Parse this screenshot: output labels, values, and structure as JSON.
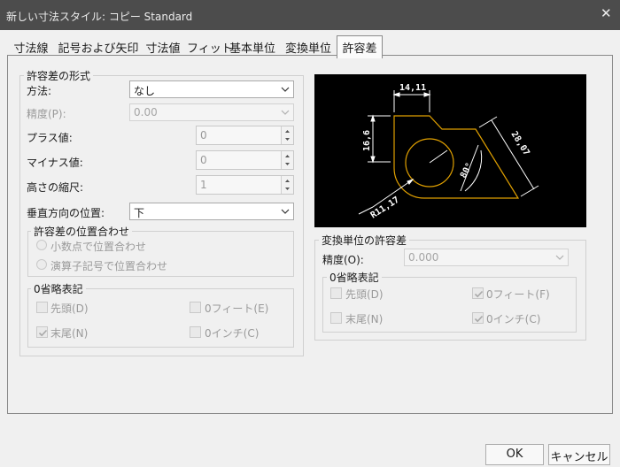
{
  "window": {
    "title": "新しい寸法スタイル: コピー Standard",
    "close_glyph": "✕"
  },
  "tabs": [
    {
      "label": "寸法線",
      "active": false
    },
    {
      "label": "記号および矢印",
      "active": false
    },
    {
      "label": "寸法値",
      "active": false
    },
    {
      "label": "フィット",
      "active": false
    },
    {
      "label": "基本単位",
      "active": false
    },
    {
      "label": "変換単位",
      "active": false
    },
    {
      "label": "許容差",
      "active": true
    }
  ],
  "tolerance_format": {
    "group_title": "許容差の形式",
    "method_label": "方法:",
    "method_value": "なし",
    "precision_label": "精度(P):",
    "precision_value": "0.00",
    "plus_label": "プラス値:",
    "plus_value": "0",
    "minus_label": "マイナス値:",
    "minus_value": "0",
    "height_scale_label": "高さの縮尺:",
    "height_scale_value": "1",
    "vertical_position_label": "垂直方向の位置:",
    "vertical_position_value": "下"
  },
  "tolerance_alignment": {
    "group_title": "許容差の位置合わせ",
    "option_decimal": "小数点で位置合わせ",
    "option_operator": "演算子記号で位置合わせ"
  },
  "zero_suppression": {
    "group_title": "0省略表記",
    "leading": "先頭(D)",
    "leading_checked": false,
    "feet": "0フィート(E)",
    "feet_checked": false,
    "trailing": "末尾(N)",
    "trailing_checked": true,
    "inches": "0インチ(C)",
    "inches_checked": false
  },
  "preview": {
    "dim_top": "14,11",
    "dim_left": "16,6",
    "dim_right": "28,07",
    "dim_angle": "80°",
    "dim_radius": "R11,17",
    "line_color": "#e0a000",
    "dim_color": "#ffffff"
  },
  "alternate_units_tolerance": {
    "group_title": "変換単位の許容差",
    "precision_label": "精度(O):",
    "precision_value": "0.000"
  },
  "alt_zero_suppression": {
    "group_title": "0省略表記",
    "leading": "先頭(D)",
    "leading_checked": false,
    "feet": "0フィート(F)",
    "feet_checked": true,
    "trailing": "末尾(N)",
    "trailing_checked": false,
    "inches": "0インチ(C)",
    "inches_checked": true
  },
  "footer": {
    "ok_label": "OK",
    "cancel_label": "キャンセル"
  }
}
